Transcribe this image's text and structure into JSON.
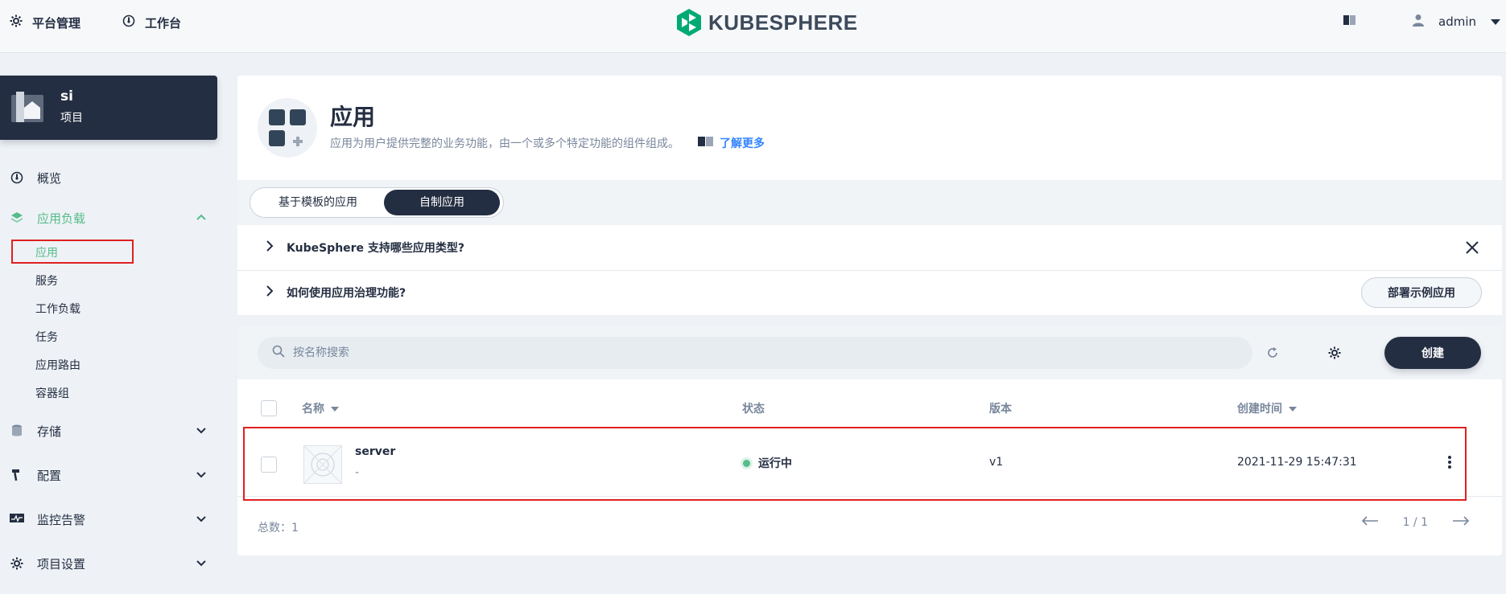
{
  "topbar": {
    "platform_label": "平台管理",
    "workbench_label": "工作台",
    "logo_text": "KUBESPHERE",
    "user_name": "admin"
  },
  "project": {
    "name": "si",
    "type": "项目"
  },
  "sidebar": {
    "overview": "概览",
    "workloads_group": "应用负载",
    "workloads_items": [
      "应用",
      "服务",
      "工作负载",
      "任务",
      "应用路由",
      "容器组"
    ],
    "storage": "存储",
    "config": "配置",
    "monitoring": "监控告警",
    "settings": "项目设置"
  },
  "header": {
    "title": "应用",
    "description": "应用为用户提供完整的业务功能，由一个或多个特定功能的组件组成。",
    "learn_more": "了解更多"
  },
  "tabs": [
    {
      "label": "基于模板的应用",
      "active": false
    },
    {
      "label": "自制应用",
      "active": true
    }
  ],
  "faq": {
    "q1": "KubeSphere 支持哪些应用类型?",
    "q2": "如何使用应用治理功能?",
    "deploy_sample": "部署示例应用"
  },
  "toolbar": {
    "search_placeholder": "按名称搜索",
    "create_label": "创建"
  },
  "table": {
    "columns": {
      "name": "名称",
      "status": "状态",
      "version": "版本",
      "created": "创建时间"
    },
    "rows": [
      {
        "name": "server",
        "description": "-",
        "status": "运行中",
        "version": "v1",
        "created": "2021-11-29 15:47:31"
      }
    ]
  },
  "footer": {
    "total": "总数：1",
    "page": "1 / 1"
  },
  "colors": {
    "accent": "#55bc8a",
    "dark": "#242e42",
    "highlight": "#e02020"
  }
}
